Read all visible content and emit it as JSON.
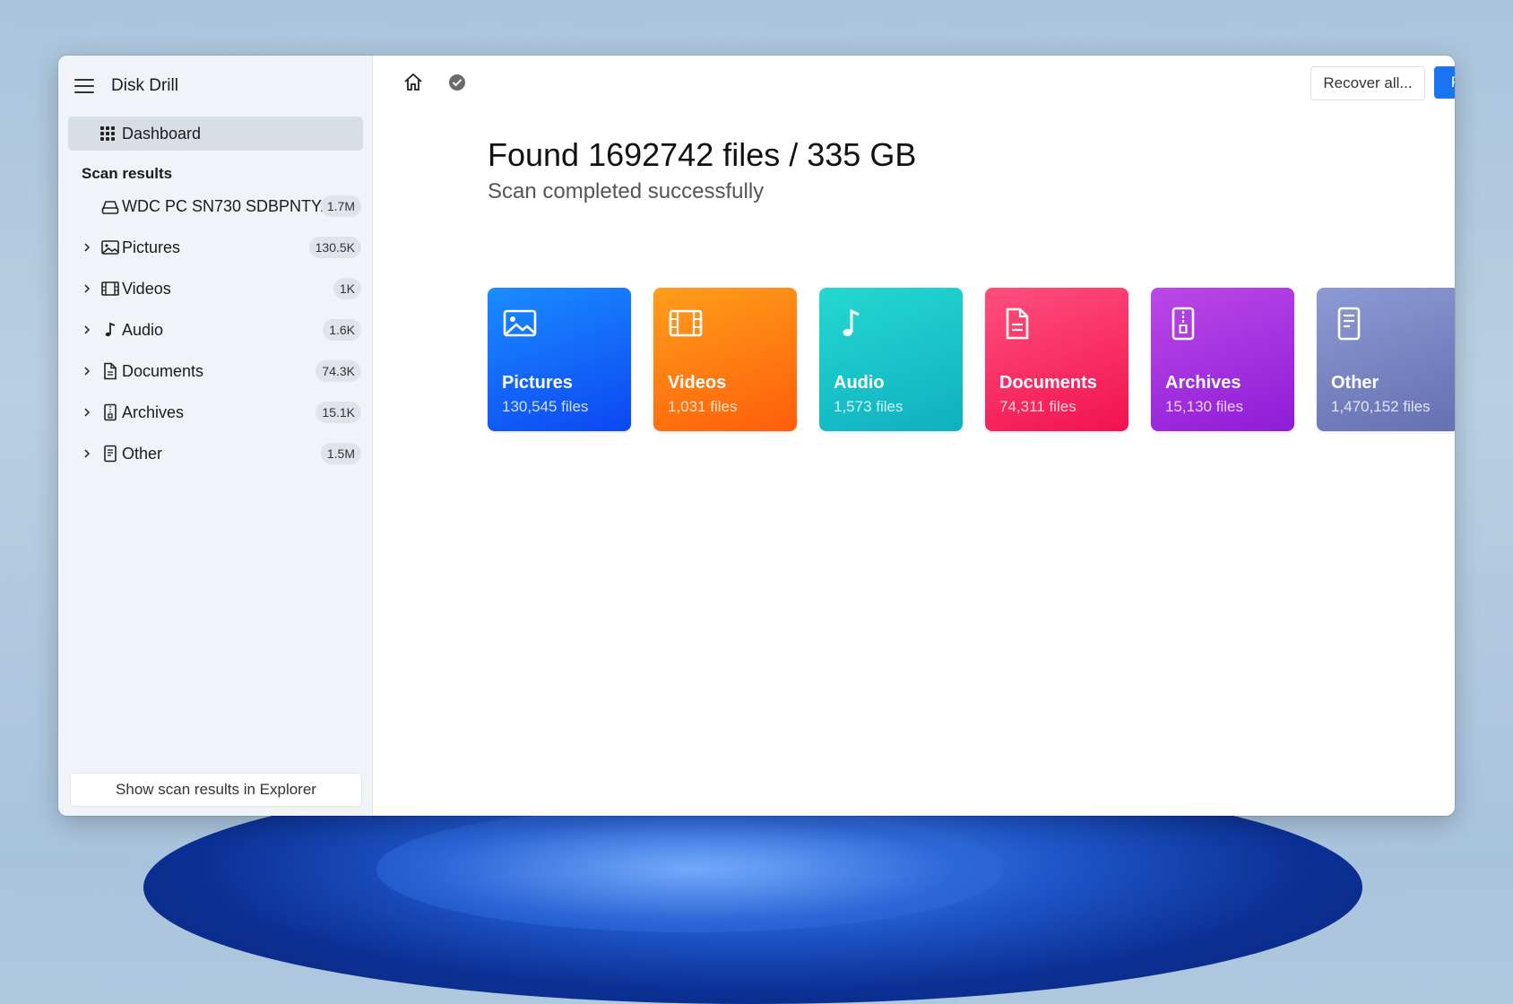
{
  "app": {
    "title": "Disk Drill"
  },
  "sidebar": {
    "dashboard_label": "Dashboard",
    "section_title": "Scan results",
    "drive": {
      "label": "WDC PC SN730 SDBPNTY...",
      "count": "1.7M"
    },
    "items": [
      {
        "label": "Pictures",
        "count": "130.5K",
        "icon": "image-icon"
      },
      {
        "label": "Videos",
        "count": "1K",
        "icon": "film-icon"
      },
      {
        "label": "Audio",
        "count": "1.6K",
        "icon": "music-note-icon"
      },
      {
        "label": "Documents",
        "count": "74.3K",
        "icon": "document-icon"
      },
      {
        "label": "Archives",
        "count": "15.1K",
        "icon": "archive-icon"
      },
      {
        "label": "Other",
        "count": "1.5M",
        "icon": "file-icon"
      }
    ],
    "explorer_button": "Show scan results in Explorer"
  },
  "toolbar": {
    "recover_label": "Recover all...",
    "review_label": "Review found items"
  },
  "main": {
    "title": "Found 1692742 files / 335 GB",
    "subtitle": "Scan completed successfully",
    "cards": [
      {
        "name": "Pictures",
        "count": "130,545 files",
        "icon": "image-icon"
      },
      {
        "name": "Videos",
        "count": "1,031 files",
        "icon": "film-icon"
      },
      {
        "name": "Audio",
        "count": "1,573 files",
        "icon": "music-note-icon"
      },
      {
        "name": "Documents",
        "count": "74,311 files",
        "icon": "document-icon"
      },
      {
        "name": "Archives",
        "count": "15,130 files",
        "icon": "archive-icon"
      },
      {
        "name": "Other",
        "count": "1,470,152 files",
        "icon": "file-icon"
      }
    ]
  },
  "colors": {
    "accent": "#1a73f0",
    "pictures": "#0d47f2",
    "videos": "#ff5e0a",
    "audio": "#0fb0bf",
    "documents": "#f2124f",
    "archives": "#8f1cd8",
    "other": "#6470b0"
  }
}
